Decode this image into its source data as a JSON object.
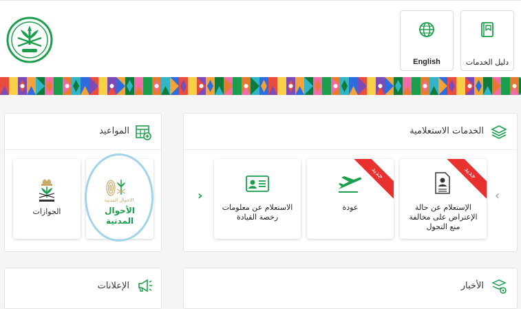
{
  "header": {
    "services_guide_label": "دليل الخدمات",
    "language_label": "English",
    "logo_icon": "saudi-emblem-icon"
  },
  "colors": {
    "brand_green": "#1a9e4b",
    "ribbon_red": "#e8312f",
    "highlight_blue": "#9fd4ea"
  },
  "inquiry": {
    "title": "الخدمات الاستعلامية",
    "icon": "layers-icon",
    "cards": [
      {
        "label": "الإستعلام عن حالة الإعتراض على مخالفة منع التجول",
        "badge": "جديد",
        "icon": "document-person-icon"
      },
      {
        "label": "عودة",
        "badge": "جديد",
        "icon": "airplane-icon"
      },
      {
        "label": "الاستعلام عن معلومات رخصة القيادة",
        "badge": "",
        "icon": "id-card-icon"
      }
    ]
  },
  "appointments": {
    "title": "المواعيد",
    "icon": "calendar-add-icon",
    "cards": [
      {
        "label": "الأحوال المدنية",
        "logo_caption": "الاحوال المدنية",
        "icon": "civil-affairs-logo-icon"
      },
      {
        "label": "الجوازات",
        "icon": "passports-logo-icon"
      }
    ]
  },
  "news": {
    "title": "الأخبار",
    "icon": "news-gear-icon"
  },
  "announcements": {
    "title": "الإعلانات",
    "icon": "megaphone-icon"
  }
}
